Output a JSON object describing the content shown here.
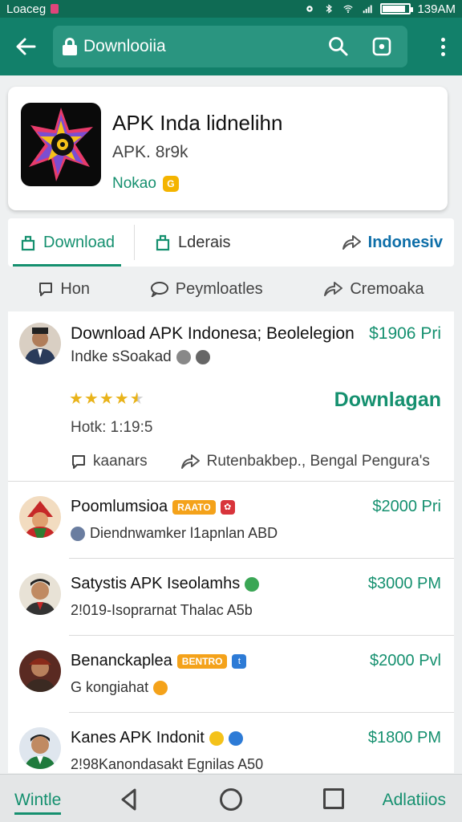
{
  "status_bar": {
    "carrier": "Loaceg",
    "time": "139AM",
    "battery_level": 0.85
  },
  "app_bar": {
    "url": "Downlooiia"
  },
  "app_card": {
    "title": "APK Inda lidnelihn",
    "subtitle": "APK. 8r9k",
    "developer": "Nokao",
    "developer_badge": "G"
  },
  "tabs": [
    {
      "label": "Download",
      "active": true
    },
    {
      "label": "Lderais",
      "active": false
    },
    {
      "label": "Indonesiv",
      "active": false
    }
  ],
  "sub_tabs": [
    {
      "label": "Hon"
    },
    {
      "label": "Peymloatles"
    },
    {
      "label": "Cremoaka"
    }
  ],
  "featured": {
    "title": "Download APK Indonesa; Beolelegion",
    "price": "$1906 Pri",
    "subtitle": "Indke sSoakad",
    "rating": 4.5,
    "stars": "★★★★★",
    "download_label": "Downlagan",
    "time": "Hotk: 1:19:5",
    "action_left": "kaanars",
    "action_right": "Rutenbakbep., Bengal Pengura's"
  },
  "rows": [
    {
      "title": "Poomlumsioa",
      "badge": "RAATO",
      "price": "$2000 Pri",
      "subtitle": "Diendnwamker l1apnlan ABD",
      "accent": "#d8343b"
    },
    {
      "title": "Satystis APK Iseolamhs",
      "badge": "",
      "price": "$3000 PM",
      "subtitle": "2!019-Isoprarnat   Thalac A5b",
      "accent": "#3aa655"
    },
    {
      "title": "Benanckaplea",
      "badge": "BENTRO",
      "price": "$2000 Pvl",
      "subtitle": "G   kongiahat",
      "accent": "#2d7bd6"
    },
    {
      "title": "Kanes APK Indonit",
      "badge": "",
      "price": "$1800 PM",
      "subtitle": "2!98Kanondasakt   Egnilas A50",
      "accent": "#2d7bd6"
    }
  ],
  "bottom_nav": {
    "left_label": "Wintle",
    "right_label": "Adlatiios"
  },
  "colors": {
    "primary": "#12806a",
    "accent": "#15906f",
    "link": "#0d6ea8",
    "star": "#e9b31a"
  }
}
